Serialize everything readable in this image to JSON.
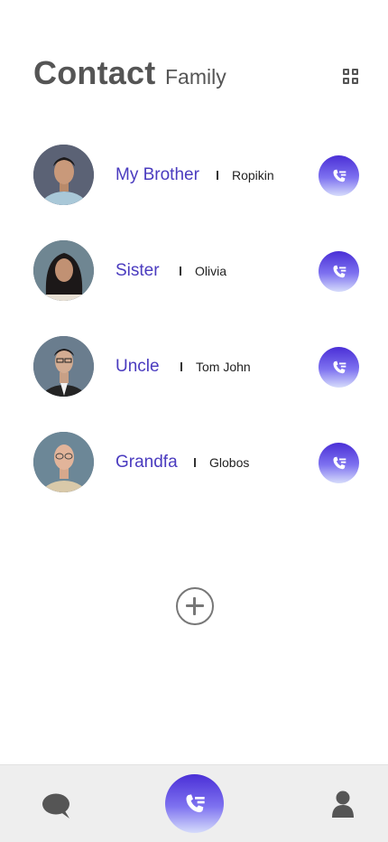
{
  "header": {
    "title": "Contact",
    "subtitle": "Family",
    "view_toggle_icon": "grid-view-icon"
  },
  "contacts": [
    {
      "name": "My Brother",
      "detail": "Ropikin",
      "avatar": "avatar-brother"
    },
    {
      "name": "Sister",
      "detail": "Olivia",
      "avatar": "avatar-sister"
    },
    {
      "name": "Uncle",
      "detail": "Tom John",
      "avatar": "avatar-uncle"
    },
    {
      "name": "Grandfa",
      "detail": "Globos",
      "avatar": "avatar-grandfa"
    }
  ],
  "add_button": {
    "icon": "plus-circle-icon"
  },
  "bottom_nav": {
    "items": [
      {
        "icon": "chat-bubble-icon"
      },
      {
        "icon": "phone-call-icon"
      },
      {
        "icon": "user-profile-icon"
      }
    ]
  },
  "colors": {
    "accent": "#4a3bbf",
    "call_gradient_top": "#4a2fd6",
    "call_gradient_bottom": "#d6dcfb",
    "text_gray": "#555555",
    "nav_background": "#eeeeee"
  }
}
